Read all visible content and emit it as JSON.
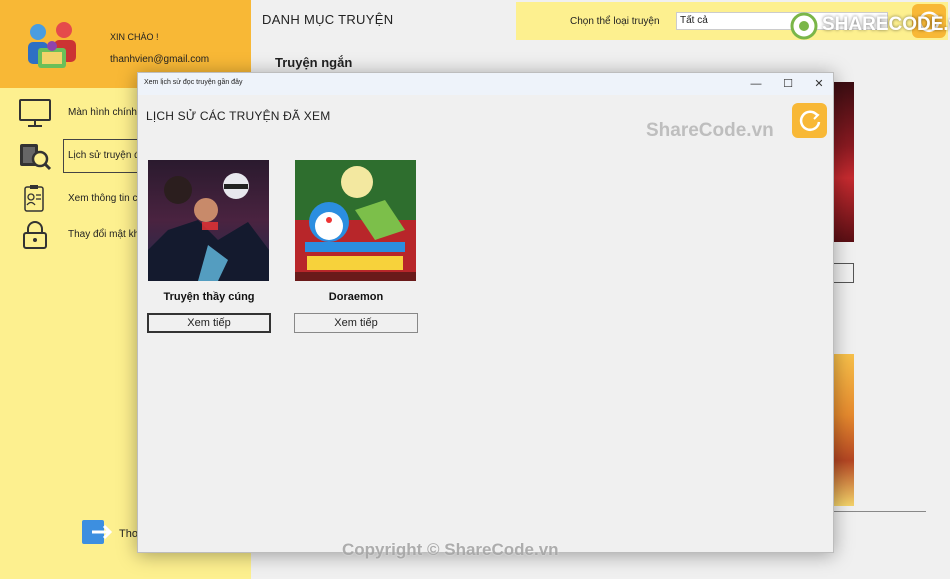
{
  "sidebar": {
    "greeting": "XIN CHÀO !",
    "email": "thanhvien@gmail.com",
    "items": [
      {
        "label": "Màn hình chính",
        "icon": "monitor-icon"
      },
      {
        "label": "Lịch sử truyện đã xem",
        "icon": "book-search-icon"
      },
      {
        "label": "Xem thông tin cá nhân",
        "icon": "id-card-icon"
      },
      {
        "label": "Thay đổi mật khẩu",
        "icon": "lock-icon"
      }
    ],
    "logout_label": "Thoát"
  },
  "main": {
    "title": "DANH MỤC TRUYỆN",
    "filter_label": "Chọn thể loại truyện",
    "filter_value": "Tất cả",
    "section_title": "Truyện ngắn"
  },
  "dialog": {
    "window_title": "Xem lịch sử đọc truyện gần đây",
    "heading": "LỊCH SỬ CÁC TRUYỆN ĐÃ XEM",
    "controls": {
      "minimize": "—",
      "maximize": "☐",
      "close": "✕"
    },
    "cards": [
      {
        "title": "Truyện thầy cúng",
        "button": "Xem tiếp"
      },
      {
        "title": "Doraemon",
        "button": "Xem tiếp"
      }
    ]
  },
  "watermarks": {
    "logo": "SHARECODE.vn",
    "mid": "ShareCode.vn",
    "bottom": "Copyright © ShareCode.vn"
  },
  "colors": {
    "sidebar_bg": "#fdf08f",
    "sidebar_header": "#f8b836",
    "accent": "#f8b836"
  }
}
